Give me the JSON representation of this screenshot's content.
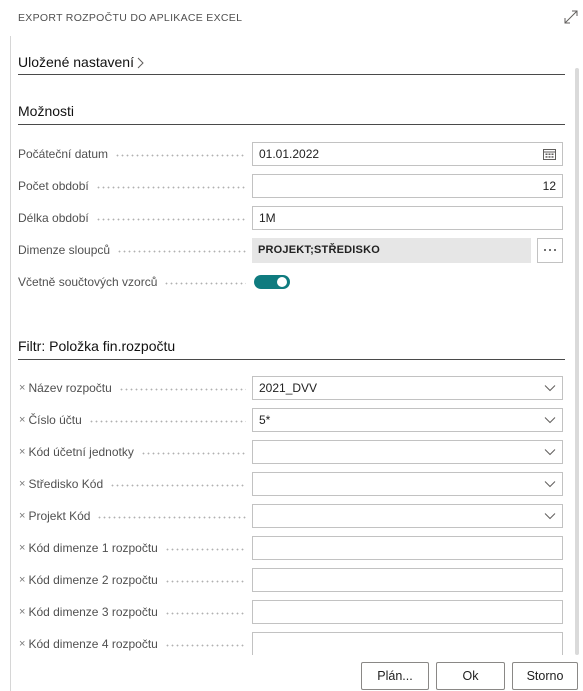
{
  "dialog": {
    "title": "EXPORT ROZPOČTU DO APLIKACE EXCEL",
    "expand_icon": "expand-icon"
  },
  "saved_settings": {
    "label": "Uložené nastavení",
    "icon": "chevron-right-icon"
  },
  "options": {
    "heading": "Možnosti",
    "start_date": {
      "label": "Počáteční datum",
      "value": "01.01.2022",
      "icon": "calendar-icon"
    },
    "period_count": {
      "label": "Počet období",
      "value": "12"
    },
    "period_length": {
      "label": "Délka období",
      "value": "1M"
    },
    "column_dimensions": {
      "label": "Dimenze sloupců",
      "value": "PROJEKT;STŘEDISKO",
      "lookup_icon": "ellipsis-icon"
    },
    "include_totals": {
      "label": "Včetně součtových vzorců",
      "value": true
    }
  },
  "filter": {
    "heading": "Filtr: Položka fin.rozpočtu",
    "remove_icon": "remove-filter-icon",
    "fields": [
      {
        "label": "Název rozpočtu",
        "value": "2021_DVV",
        "icon": "chevron-down-icon"
      },
      {
        "label": "Číslo účtu",
        "value": "5*",
        "icon": "chevron-down-icon"
      },
      {
        "label": "Kód účetní jednotky",
        "value": "",
        "icon": "chevron-down-icon"
      },
      {
        "label": "Středisko Kód",
        "value": "",
        "icon": "chevron-down-icon"
      },
      {
        "label": "Projekt Kód",
        "value": "",
        "icon": "chevron-down-icon"
      },
      {
        "label": "Kód dimenze 1 rozpočtu",
        "value": ""
      },
      {
        "label": "Kód dimenze 2 rozpočtu",
        "value": ""
      },
      {
        "label": "Kód dimenze 3 rozpočtu",
        "value": ""
      },
      {
        "label": "Kód dimenze 4 rozpočtu",
        "value": ""
      }
    ]
  },
  "actions": {
    "plan": "Plán...",
    "ok": "Ok",
    "cancel": "Storno"
  },
  "colors": {
    "accent": "#0f7b7f",
    "text": "#212121",
    "label": "#505050"
  }
}
